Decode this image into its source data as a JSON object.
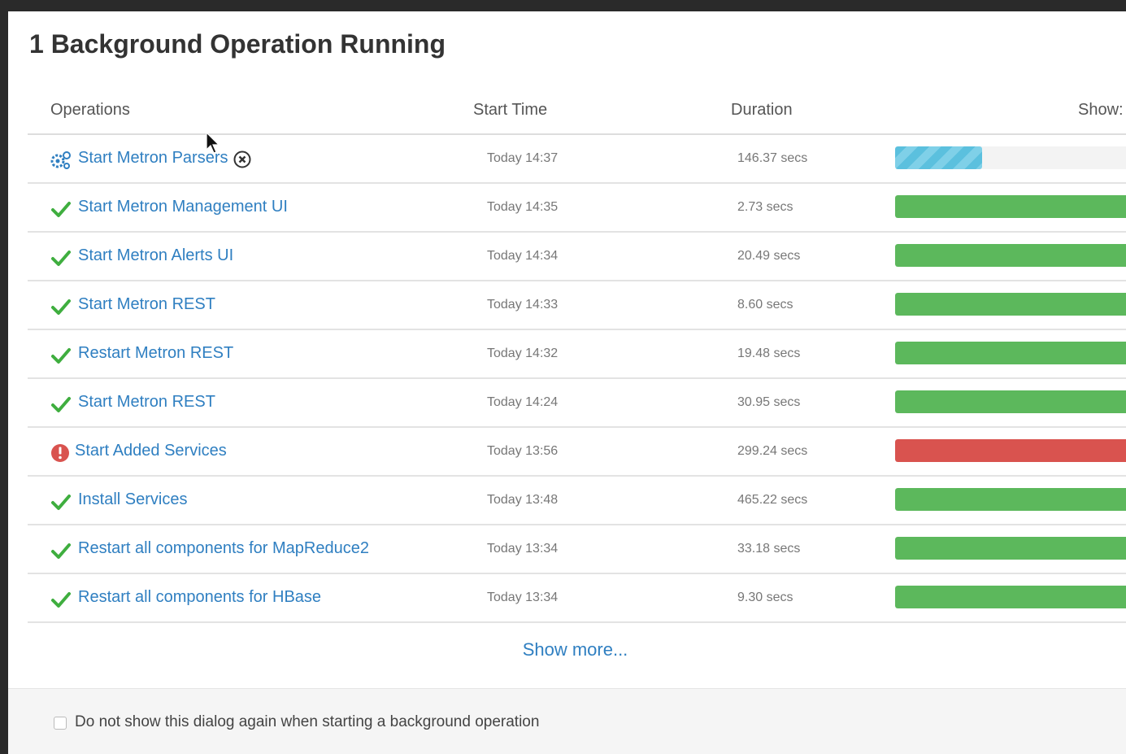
{
  "dialog": {
    "title": "1 Background Operation Running",
    "columns": {
      "operations": "Operations",
      "start_time": "Start Time",
      "duration": "Duration",
      "show": "Show:"
    },
    "rows": [
      {
        "status": "running",
        "status_icon": "gears-icon",
        "name": "Start Metron Parsers",
        "start": "Today 14:37",
        "duration": "146.37 secs",
        "progress": 0.37,
        "cancellable": true
      },
      {
        "status": "success",
        "status_icon": "checkmark-icon",
        "name": "Start Metron Management UI",
        "start": "Today 14:35",
        "duration": "2.73 secs",
        "progress": 1.0
      },
      {
        "status": "success",
        "status_icon": "checkmark-icon",
        "name": "Start Metron Alerts UI",
        "start": "Today 14:34",
        "duration": "20.49 secs",
        "progress": 1.0
      },
      {
        "status": "success",
        "status_icon": "checkmark-icon",
        "name": "Start Metron REST",
        "start": "Today 14:33",
        "duration": "8.60 secs",
        "progress": 1.0
      },
      {
        "status": "success",
        "status_icon": "checkmark-icon",
        "name": "Restart Metron REST",
        "start": "Today 14:32",
        "duration": "19.48 secs",
        "progress": 1.0
      },
      {
        "status": "success",
        "status_icon": "checkmark-icon",
        "name": "Start Metron REST",
        "start": "Today 14:24",
        "duration": "30.95 secs",
        "progress": 1.0
      },
      {
        "status": "failed",
        "status_icon": "error-icon",
        "name": "Start Added Services",
        "start": "Today 13:56",
        "duration": "299.24 secs",
        "progress": 1.0
      },
      {
        "status": "success",
        "status_icon": "checkmark-icon",
        "name": "Install Services",
        "start": "Today 13:48",
        "duration": "465.22 secs",
        "progress": 1.0
      },
      {
        "status": "success",
        "status_icon": "checkmark-icon",
        "name": "Restart all components for MapReduce2",
        "start": "Today 13:34",
        "duration": "33.18 secs",
        "progress": 1.0
      },
      {
        "status": "success",
        "status_icon": "checkmark-icon",
        "name": "Restart all components for HBase",
        "start": "Today 13:34",
        "duration": "9.30 secs",
        "progress": 1.0
      }
    ],
    "show_more": "Show more...",
    "footer": {
      "checkbox_label": "Do not show this dialog again when starting a background operation",
      "checked": false
    }
  },
  "colors": {
    "link": "#2f7fc1",
    "success": "#5cb85c",
    "failed": "#d9534f",
    "running": "#5bc0de"
  }
}
